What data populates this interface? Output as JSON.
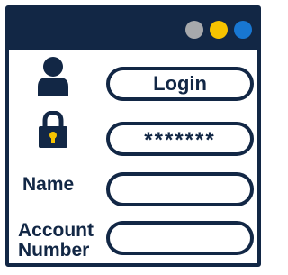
{
  "window": {
    "controls": [
      {
        "name": "gray",
        "color": "#a7a9ac"
      },
      {
        "name": "yellow",
        "color": "#f6c300"
      },
      {
        "name": "blue",
        "color": "#1877d2"
      }
    ]
  },
  "form": {
    "login_value": "Login",
    "password_value": "*******",
    "name_label": "Name",
    "name_value": "",
    "account_label_line1": "Account",
    "account_label_line2": "Number",
    "account_value": ""
  },
  "icons": {
    "user": "user-icon",
    "lock": "lock-icon"
  },
  "colors": {
    "primary": "#122745",
    "lock_keyhole": "#f6c300"
  }
}
